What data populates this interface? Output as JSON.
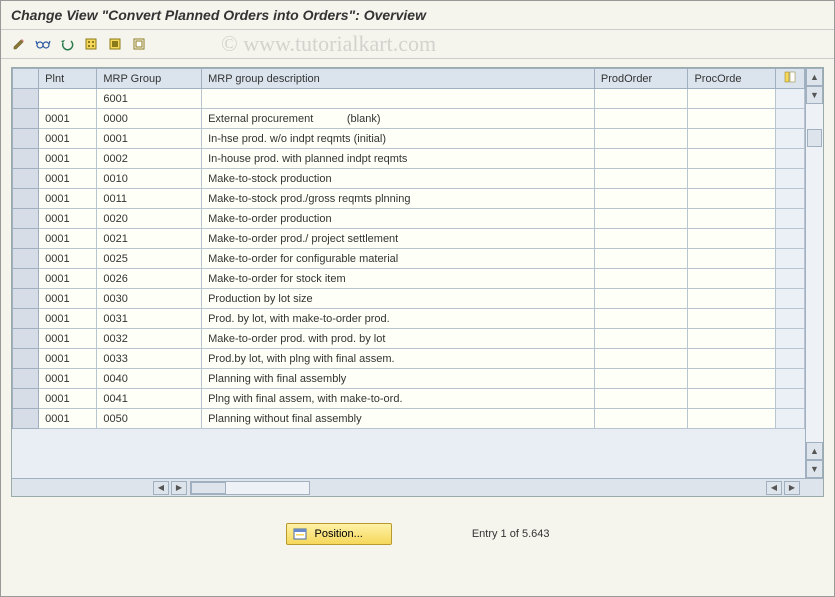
{
  "title": "Change View \"Convert Planned Orders into Orders\": Overview",
  "watermark": "© www.tutorialkart.com",
  "toolbar": {
    "items": [
      {
        "name": "tool-change",
        "icon": "pencil"
      },
      {
        "name": "tool-glass",
        "icon": "glasses"
      },
      {
        "name": "tool-undo",
        "icon": "undo"
      },
      {
        "name": "tool-select-all",
        "icon": "select-all"
      },
      {
        "name": "tool-select-block",
        "icon": "select-block"
      },
      {
        "name": "tool-deselect",
        "icon": "deselect"
      }
    ]
  },
  "table": {
    "columns": {
      "plnt": "Plnt",
      "mrp_group": "MRP Group",
      "mrp_desc": "MRP group description",
      "prod_order": "ProdOrder",
      "proc_order": "ProcOrde"
    },
    "rows": [
      {
        "plnt": "",
        "mrpg": "6001",
        "desc": "",
        "prod": "",
        "proc": ""
      },
      {
        "plnt": "0001",
        "mrpg": "0000",
        "desc": "External procurement           (blank)",
        "prod": "",
        "proc": ""
      },
      {
        "plnt": "0001",
        "mrpg": "0001",
        "desc": "In-hse prod. w/o indpt reqmts (initial)",
        "prod": "",
        "proc": ""
      },
      {
        "plnt": "0001",
        "mrpg": "0002",
        "desc": "In-house prod. with planned indpt reqmts",
        "prod": "",
        "proc": ""
      },
      {
        "plnt": "0001",
        "mrpg": "0010",
        "desc": "Make-to-stock production",
        "prod": "",
        "proc": ""
      },
      {
        "plnt": "0001",
        "mrpg": "0011",
        "desc": "Make-to-stock prod./gross reqmts plnning",
        "prod": "",
        "proc": ""
      },
      {
        "plnt": "0001",
        "mrpg": "0020",
        "desc": "Make-to-order production",
        "prod": "",
        "proc": ""
      },
      {
        "plnt": "0001",
        "mrpg": "0021",
        "desc": "Make-to-order prod./ project settlement",
        "prod": "",
        "proc": ""
      },
      {
        "plnt": "0001",
        "mrpg": "0025",
        "desc": "Make-to-order for configurable material",
        "prod": "",
        "proc": ""
      },
      {
        "plnt": "0001",
        "mrpg": "0026",
        "desc": "Make-to-order for stock item",
        "prod": "",
        "proc": ""
      },
      {
        "plnt": "0001",
        "mrpg": "0030",
        "desc": "Production by lot size",
        "prod": "",
        "proc": ""
      },
      {
        "plnt": "0001",
        "mrpg": "0031",
        "desc": "Prod. by lot, with make-to-order prod.",
        "prod": "",
        "proc": ""
      },
      {
        "plnt": "0001",
        "mrpg": "0032",
        "desc": "Make-to-order prod. with prod. by lot",
        "prod": "",
        "proc": ""
      },
      {
        "plnt": "0001",
        "mrpg": "0033",
        "desc": "Prod.by lot, with plng with final assem.",
        "prod": "",
        "proc": ""
      },
      {
        "plnt": "0001",
        "mrpg": "0040",
        "desc": "Planning with final assembly",
        "prod": "",
        "proc": ""
      },
      {
        "plnt": "0001",
        "mrpg": "0041",
        "desc": "Plng with final assem, with make-to-ord.",
        "prod": "",
        "proc": ""
      },
      {
        "plnt": "0001",
        "mrpg": "0050",
        "desc": "Planning without final assembly",
        "prod": "",
        "proc": ""
      }
    ]
  },
  "footer": {
    "position_label": "Position...",
    "entry_label": "Entry 1 of 5.643"
  }
}
